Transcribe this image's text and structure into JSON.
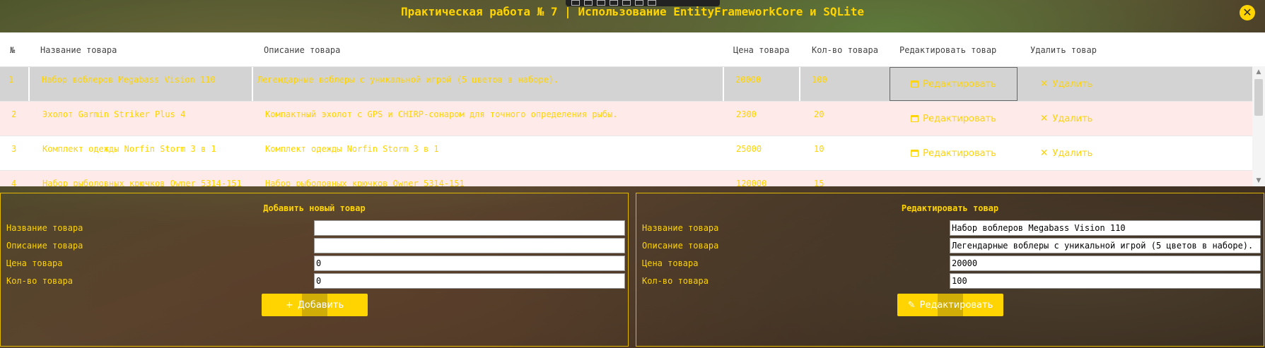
{
  "window": {
    "title": "Практическая работа № 7 | Использование EntityFrameworkCore и SQLite",
    "close_glyph": "✕"
  },
  "grid": {
    "columns": [
      "№",
      "Название товара",
      "Описание товара",
      "Цена товара",
      "Кол-во товара",
      "Редактировать товар",
      "Удалить товар"
    ],
    "rows": [
      {
        "id": "1",
        "name": "Набор воблеров Megabass Vision 110",
        "desc": "Легендарные воблеры с уникальной игрой (5 цветов в наборе).",
        "price": "20000",
        "qty": "100"
      },
      {
        "id": "2",
        "name": "Эхолот Garmin Striker Plus 4",
        "desc": "Компактный эхолот с GPS и CHIRP-сонаром для точного определения рыбы.",
        "price": "2300",
        "qty": "20"
      },
      {
        "id": "3",
        "name": "Комплект одежды Norfin Storm 3 в 1",
        "desc": "Комплект одежды Norfin Storm 3 в 1",
        "price": "25000",
        "qty": "10"
      },
      {
        "id": "4",
        "name": "Набор рыболовных крючков Owner 5314-151",
        "desc": "Набор рыболовных крючков Owner 5314-151",
        "price": "120000",
        "qty": "15"
      }
    ],
    "edit_label": "Редактировать",
    "delete_label": "Удалить",
    "delete_glyph": "✕",
    "scroll_up_glyph": "▲",
    "scroll_down_glyph": "▼"
  },
  "add_panel": {
    "title": "Добавить новый товар",
    "name_label": "Название товара",
    "desc_label": "Описание товара",
    "price_label": "Цена товара",
    "qty_label": "Кол-во товара",
    "name_value": "",
    "desc_value": "",
    "price_value": "0",
    "qty_value": "0",
    "button_glyph": "+",
    "button_label": "Добавить"
  },
  "edit_panel": {
    "title": "Редактировать товар",
    "name_label": "Название товара",
    "desc_label": "Описание товара",
    "price_label": "Цена товара",
    "qty_label": "Кол-во товара",
    "name_value": "Набор воблеров Megabass Vision 110",
    "desc_value": "Легендарные воблеры с уникальной игрой (5 цветов в наборе).",
    "price_value": "20000",
    "qty_value": "100",
    "button_glyph": "✎",
    "button_label": "Редактировать"
  },
  "colors": {
    "accent": "#ffd400",
    "selected_row": "#d3d3d3",
    "alt_row": "#ffeaea"
  }
}
